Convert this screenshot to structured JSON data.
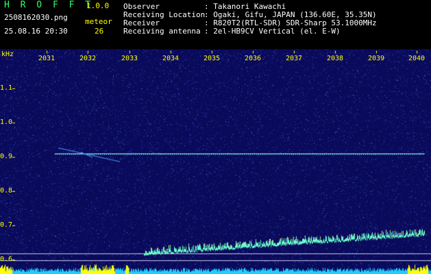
{
  "header": {
    "app_title": "H R O F F T",
    "app_version": "1.0.0",
    "filename": "2508162030.png",
    "timestamp": "25.08.16 20:30",
    "meteor_label": "meteor",
    "meteor_count": "26",
    "info": [
      {
        "label": "Observer",
        "value": ": Takanori Kawachi"
      },
      {
        "label": "Receiving Location",
        "value": ": Ogaki, Gifu, JAPAN (136.60E, 35.35N)"
      },
      {
        "label": "Receiver",
        "value": ": R820T2(RTL-SDR) SDR-Sharp 53.1000MHz"
      },
      {
        "label": "Receiving antenna",
        "value": ": 2el-HB9CV Vertical (el. E-W)"
      }
    ]
  },
  "spectrogram": {
    "y_unit": "kHz",
    "y_ticks": [
      "1.1",
      "1.0",
      "0.9",
      "0.8",
      "0.7",
      "0.6"
    ],
    "x_ticks": [
      "2031",
      "2032",
      "2033",
      "2034",
      "2035",
      "2036",
      "2037",
      "2038",
      "2039",
      "2040"
    ],
    "colors": {
      "background": "#0a0a5a",
      "signal": "#66ffcc",
      "axis_text": "#ffff00"
    }
  }
}
